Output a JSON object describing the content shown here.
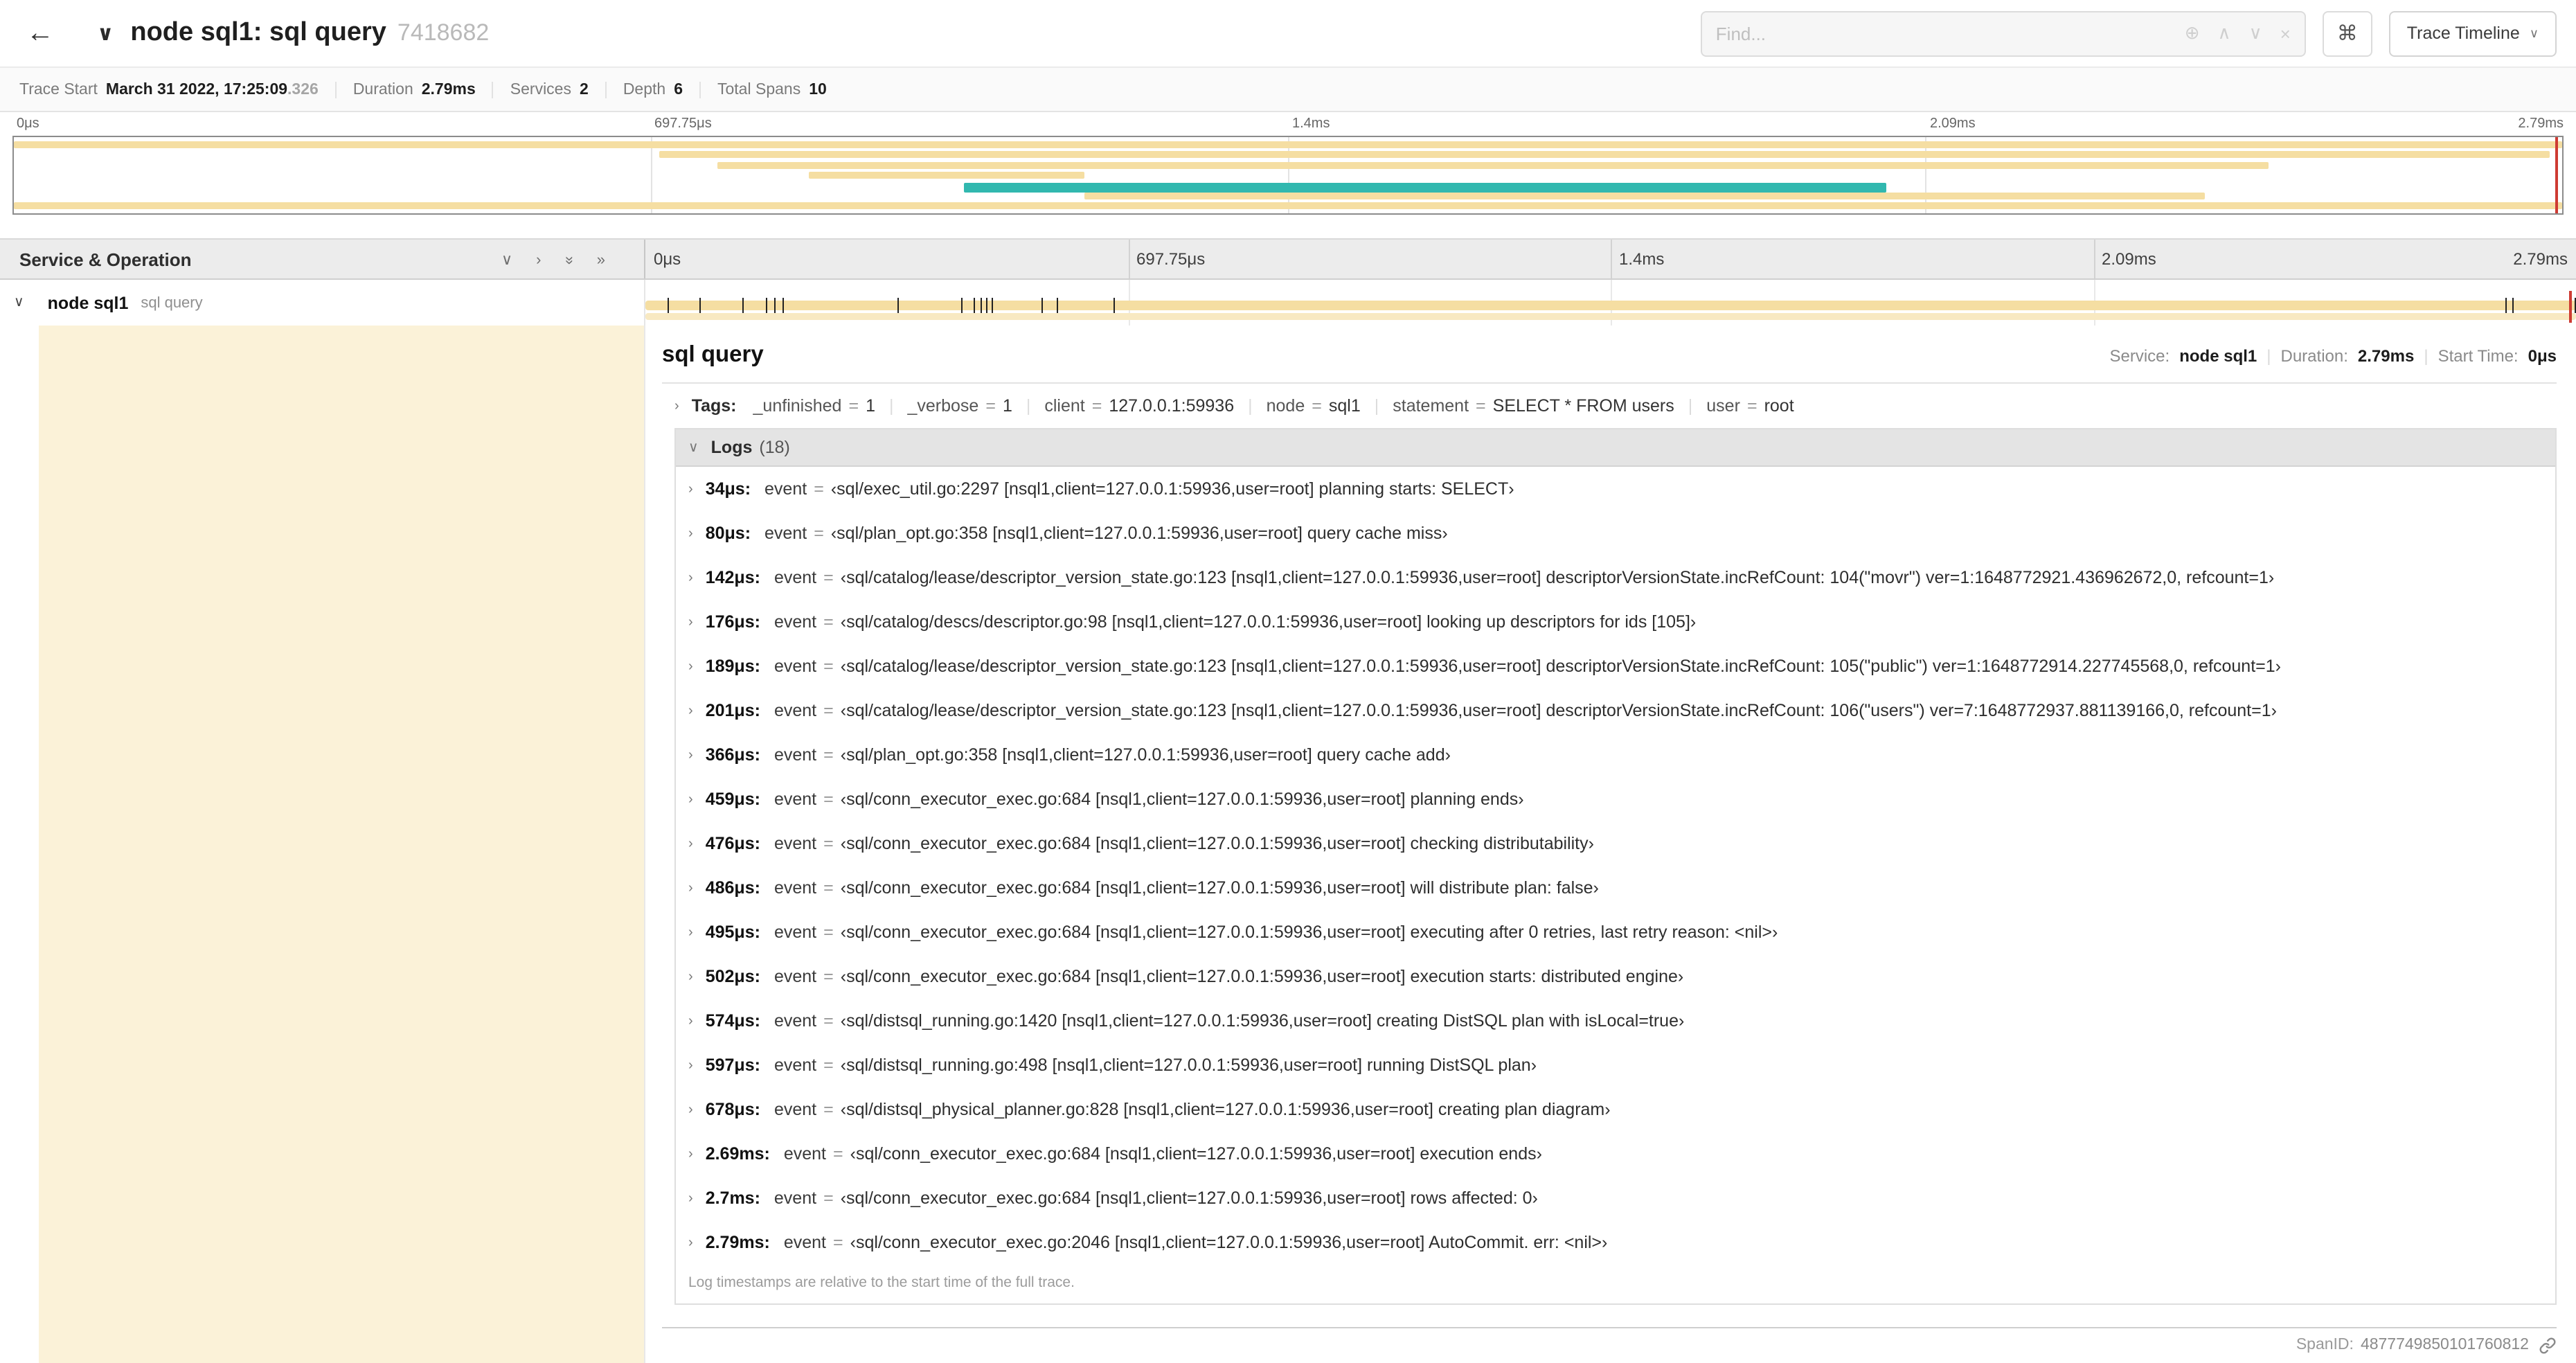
{
  "colors": {
    "span_tan": "#F5DEA2",
    "span_tan_light": "#F8E9C2",
    "teal": "#31B8AF",
    "cream": "#FBF2D8",
    "red_marker": "#CE3B33"
  },
  "icons": {
    "chevron_right": "›",
    "chevron_down": "∨"
  },
  "header": {
    "back_icon": "←",
    "chevron_icon": "∨",
    "title": "node sql1: sql query",
    "trace_id": "7418682",
    "find_placeholder": "Find...",
    "find_icons": [
      {
        "name": "zoom-plus-icon",
        "glyph": "⊕"
      },
      {
        "name": "prev-result-icon",
        "glyph": "∧"
      },
      {
        "name": "next-result-icon",
        "glyph": "∨"
      },
      {
        "name": "clear-search-icon",
        "glyph": "×"
      }
    ],
    "shortcut_icon": "⌘",
    "view_selector": "Trace Timeline",
    "view_caret": "∨"
  },
  "summary": {
    "items": [
      {
        "id": "trace-start",
        "label": "Trace Start",
        "value": "March 31 2022, 17:25:09",
        "suffix": ".326"
      },
      {
        "id": "duration",
        "label": "Duration",
        "value": "2.79ms"
      },
      {
        "id": "services",
        "label": "Services",
        "value": "2"
      },
      {
        "id": "depth",
        "label": "Depth",
        "value": "6"
      },
      {
        "id": "total-spans",
        "label": "Total Spans",
        "value": "10"
      }
    ]
  },
  "timeline": {
    "duration_us": 2790,
    "ticks": [
      {
        "label": "0μs",
        "pct": 0
      },
      {
        "label": "697.75μs",
        "pct": 25
      },
      {
        "label": "1.4ms",
        "pct": 50
      },
      {
        "label": "2.09ms",
        "pct": 75
      },
      {
        "label": "2.79ms",
        "pct": 100
      }
    ],
    "gridlines": [
      25,
      50,
      75
    ],
    "left_header": "Service & Operation",
    "controls": [
      {
        "name": "collapse-one-icon",
        "glyph": "∨"
      },
      {
        "name": "expand-one-icon",
        "glyph": "›"
      },
      {
        "name": "collapse-all-icon",
        "glyph": "»",
        "rotate": true
      },
      {
        "name": "expand-all-icon",
        "glyph": "»"
      }
    ],
    "row": {
      "chevron": "∨",
      "service": "node sql1",
      "operation": "sql query",
      "bars": [
        {
          "start": 0,
          "end": 100,
          "layer": 0
        },
        {
          "start": 0,
          "end": 100,
          "layer": 1
        }
      ]
    }
  },
  "minimap": {
    "bars": [
      {
        "row": 0,
        "start": 0,
        "end": 100,
        "color": "tan"
      },
      {
        "row": 1,
        "start": 25.3,
        "end": 99.5,
        "color": "tan"
      },
      {
        "row": 2,
        "start": 27.6,
        "end": 88.5,
        "color": "tan"
      },
      {
        "row": 3,
        "start": 31.2,
        "end": 42,
        "color": "tan"
      },
      {
        "row": 4,
        "start": 37.3,
        "end": 73.5,
        "color": "teal"
      },
      {
        "row": 5,
        "start": 42,
        "end": 86,
        "color": "tan"
      },
      {
        "row": 6,
        "start": 0,
        "end": 100,
        "color": "tan"
      }
    ]
  },
  "detail": {
    "operation": "sql query",
    "separator": "|",
    "eq": "=",
    "meta": {
      "service_label": "Service:",
      "service": "node sql1",
      "duration_label": "Duration:",
      "duration": "2.79ms",
      "start_label": "Start Time:",
      "start": "0μs"
    },
    "tags_label": "Tags:",
    "tags": [
      {
        "key": "_unfinished",
        "value": "1"
      },
      {
        "key": "_verbose",
        "value": "1"
      },
      {
        "key": "client",
        "value": "127.0.0.1:59936"
      },
      {
        "key": "node",
        "value": "sql1"
      },
      {
        "key": "statement",
        "value": "SELECT * FROM users"
      },
      {
        "key": "user",
        "value": "root"
      }
    ],
    "logs_label": "Logs",
    "logs_count": "(18)",
    "logs": [
      {
        "t": "34μs:",
        "t_us": 34,
        "field": "event",
        "value": "‹sql/exec_util.go:2297 [nsql1,client=127.0.0.1:59936,user=root] planning starts: SELECT›"
      },
      {
        "t": "80μs:",
        "t_us": 80,
        "field": "event",
        "value": "‹sql/plan_opt.go:358 [nsql1,client=127.0.0.1:59936,user=root] query cache miss›"
      },
      {
        "t": "142μs:",
        "t_us": 142,
        "field": "event",
        "value": "‹sql/catalog/lease/descriptor_version_state.go:123 [nsql1,client=127.0.0.1:59936,user=root] descriptorVersionState.incRefCount: 104(\"movr\") ver=1:1648772921.436962672,0, refcount=1›"
      },
      {
        "t": "176μs:",
        "t_us": 176,
        "field": "event",
        "value": "‹sql/catalog/descs/descriptor.go:98 [nsql1,client=127.0.0.1:59936,user=root] looking up descriptors for ids [105]›"
      },
      {
        "t": "189μs:",
        "t_us": 189,
        "field": "event",
        "value": "‹sql/catalog/lease/descriptor_version_state.go:123 [nsql1,client=127.0.0.1:59936,user=root] descriptorVersionState.incRefCount: 105(\"public\") ver=1:1648772914.227745568,0, refcount=1›"
      },
      {
        "t": "201μs:",
        "t_us": 201,
        "field": "event",
        "value": "‹sql/catalog/lease/descriptor_version_state.go:123 [nsql1,client=127.0.0.1:59936,user=root] descriptorVersionState.incRefCount: 106(\"users\") ver=7:1648772937.881139166,0, refcount=1›"
      },
      {
        "t": "366μs:",
        "t_us": 366,
        "field": "event",
        "value": "‹sql/plan_opt.go:358 [nsql1,client=127.0.0.1:59936,user=root] query cache add›"
      },
      {
        "t": "459μs:",
        "t_us": 459,
        "field": "event",
        "value": "‹sql/conn_executor_exec.go:684 [nsql1,client=127.0.0.1:59936,user=root] planning ends›"
      },
      {
        "t": "476μs:",
        "t_us": 476,
        "field": "event",
        "value": "‹sql/conn_executor_exec.go:684 [nsql1,client=127.0.0.1:59936,user=root] checking distributability›"
      },
      {
        "t": "486μs:",
        "t_us": 486,
        "field": "event",
        "value": "‹sql/conn_executor_exec.go:684 [nsql1,client=127.0.0.1:59936,user=root] will distribute plan: false›"
      },
      {
        "t": "495μs:",
        "t_us": 495,
        "field": "event",
        "value": "‹sql/conn_executor_exec.go:684 [nsql1,client=127.0.0.1:59936,user=root] executing after 0 retries, last retry reason: <nil>›"
      },
      {
        "t": "502μs:",
        "t_us": 502,
        "field": "event",
        "value": "‹sql/conn_executor_exec.go:684 [nsql1,client=127.0.0.1:59936,user=root] execution starts: distributed engine›"
      },
      {
        "t": "574μs:",
        "t_us": 574,
        "field": "event",
        "value": "‹sql/distsql_running.go:1420 [nsql1,client=127.0.0.1:59936,user=root] creating DistSQL plan with isLocal=true›"
      },
      {
        "t": "597μs:",
        "t_us": 597,
        "field": "event",
        "value": "‹sql/distsql_running.go:498 [nsql1,client=127.0.0.1:59936,user=root] running DistSQL plan›"
      },
      {
        "t": "678μs:",
        "t_us": 678,
        "field": "event",
        "value": "‹sql/distsql_physical_planner.go:828 [nsql1,client=127.0.0.1:59936,user=root] creating plan diagram›"
      },
      {
        "t": "2.69ms:",
        "t_us": 2690,
        "field": "event",
        "value": "‹sql/conn_executor_exec.go:684 [nsql1,client=127.0.0.1:59936,user=root] execution ends›"
      },
      {
        "t": "2.7ms:",
        "t_us": 2700,
        "field": "event",
        "value": "‹sql/conn_executor_exec.go:684 [nsql1,client=127.0.0.1:59936,user=root] rows affected: 0›"
      },
      {
        "t": "2.79ms:",
        "t_us": 2790,
        "field": "event",
        "value": "‹sql/conn_executor_exec.go:2046 [nsql1,client=127.0.0.1:59936,user=root] AutoCommit. err: <nil>›"
      }
    ],
    "footnote": "Log timestamps are relative to the start time of the full trace.",
    "span_id_label": "SpanID:",
    "span_id": "4877749850101760812"
  }
}
